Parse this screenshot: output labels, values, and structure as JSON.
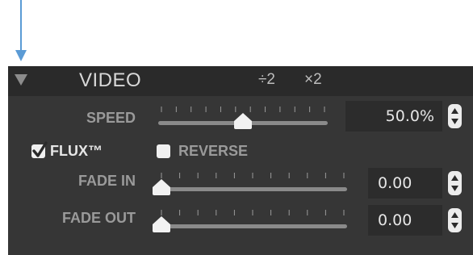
{
  "colors": {
    "arrow": "#5b9bd5",
    "panel": "#363636",
    "header": "#2a2a2a",
    "text_bright": "#e6e6e6",
    "text_dim": "#9a9a9a"
  },
  "header": {
    "title": "VIDEO",
    "divide_label": "÷2",
    "multiply_label": "×2",
    "collapse_icon": "triangle-down-icon"
  },
  "speed": {
    "label": "SPEED",
    "value": "50.0%",
    "level": 0.5
  },
  "flux": {
    "label": "FLUX™",
    "checked": true
  },
  "reverse": {
    "label": "REVERSE",
    "checked": false
  },
  "fade_in": {
    "label": "FADE IN",
    "value": "0.00",
    "level": 0
  },
  "fade_out": {
    "label": "FADE OUT",
    "value": "0.00",
    "level": 0
  }
}
